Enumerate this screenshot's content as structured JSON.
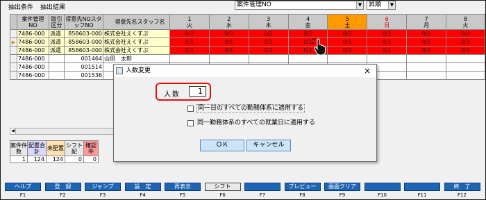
{
  "tabs": [
    "抽出条件",
    "抽出結果"
  ],
  "top_combo": {
    "value": "案件管理NO",
    "sort": "昇順"
  },
  "left_headers": [
    "案件管理NO",
    "取引区分",
    "得意先NOスタッフNO",
    "得意先名スタッフ名"
  ],
  "left_rows": [
    {
      "no": "7486-000",
      "kubun": "派遣",
      "code": "858603-000",
      "name": "株式会社えくすぷ",
      "sel": true,
      "ptr": false
    },
    {
      "no": "7486-000",
      "kubun": "派遣",
      "code": "858603-000",
      "name": "株式会社えくすぷ",
      "sel": true,
      "ptr": true
    },
    {
      "no": "7486-000",
      "kubun": "派遣",
      "code": "858603-000",
      "name": "株式会社えくすぷ",
      "sel": true,
      "ptr": false
    },
    {
      "no": "7486-000",
      "kubun": "",
      "code": "001464",
      "name": "山田　太郎",
      "sel": false,
      "ptr": false
    },
    {
      "no": "7486-000",
      "kubun": "",
      "code": "001514",
      "name": "",
      "sel": false,
      "ptr": false
    },
    {
      "no": "7486-000",
      "kubun": "",
      "code": "001536",
      "name": "",
      "sel": false,
      "ptr": false
    }
  ],
  "pointer_glyph": "▶",
  "cal_days": [
    {
      "d": "1",
      "w": "火"
    },
    {
      "d": "2",
      "w": "水"
    },
    {
      "d": "3",
      "w": "木"
    },
    {
      "d": "4",
      "w": "金"
    },
    {
      "d": "5",
      "w": "土"
    },
    {
      "d": "6",
      "w": "日"
    },
    {
      "d": "7",
      "w": "月"
    },
    {
      "d": "8",
      "w": "火"
    }
  ],
  "cal_rows": [
    [
      "0/2",
      "0/2",
      "0/2",
      "0/2",
      "0/2",
      "0/2",
      "0/2",
      "0/2"
    ],
    [
      "0/1",
      "0/1",
      "0/1",
      "0/1",
      "0/1",
      "0/1",
      "0/1",
      "0/1"
    ],
    [
      "0/1",
      "0/1",
      "0/1",
      "0/1",
      "0/1",
      "0/1",
      "0/1",
      "0/1"
    ]
  ],
  "summary_headers": [
    "案件件数",
    "配置合計",
    "未配置",
    "シフト配",
    "確認中"
  ],
  "summary_values": [
    "1",
    "124",
    "124",
    "0",
    "0"
  ],
  "dialog": {
    "title": "人数変更",
    "close": "×",
    "person_label": "人数",
    "person_value": "1",
    "check1": "同一日のすべての勤務体系に適用する",
    "check2": "同一勤務体系のすべての就業日に適用する",
    "ok": "ＯＫ",
    "cancel": "キャンセル"
  },
  "fkeys": [
    {
      "label": "ヘルプ",
      "key": "F1"
    },
    {
      "label": "登　録",
      "key": "F2"
    },
    {
      "label": "ジャンプ",
      "key": "F3"
    },
    {
      "label": "設　定",
      "key": "F4"
    },
    {
      "label": "再表示",
      "key": "F5"
    },
    {
      "label": "シフト",
      "key": "F6"
    },
    {
      "label": "",
      "key": "F7"
    },
    {
      "label": "プレビュー",
      "key": "F8"
    },
    {
      "label": "画面クリア",
      "key": "F9"
    },
    {
      "label": "",
      "key": "F10"
    },
    {
      "label": "",
      "key": "F11"
    },
    {
      "label": "終　了",
      "key": "F12"
    }
  ],
  "colors": {
    "red": "#ff0000",
    "today": "#ff9900",
    "fkey": "#1e64b4",
    "highlight": "#e31010"
  }
}
